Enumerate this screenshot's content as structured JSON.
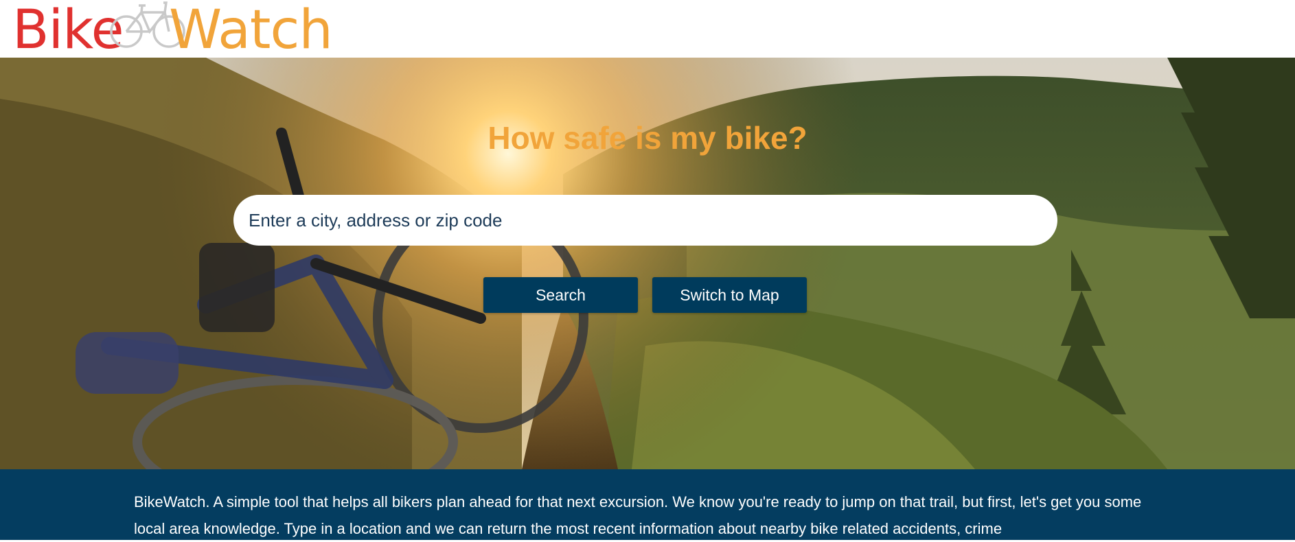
{
  "logo": {
    "part1": "Bike",
    "part2": "Watch",
    "color1": "#e0312f",
    "color2": "#f1a43a",
    "icon": "bicycle-icon"
  },
  "hero": {
    "title": "How safe is my bike?",
    "title_color": "#f1a43a",
    "background": "mountain-bike-trail-sunset-photo"
  },
  "search": {
    "placeholder": "Enter a city, address or zip code",
    "value": ""
  },
  "buttons": {
    "search_label": "Search",
    "map_label": "Switch to Map",
    "color": "#003b5c"
  },
  "info": {
    "text": "BikeWatch. A simple tool that helps all bikers plan ahead for that next excursion. We know you're ready to jump on that trail, but first, let's get you some local area knowledge. Type in a location and we can return the most recent information about nearby bike related accidents, crime",
    "background": "#043d60"
  }
}
